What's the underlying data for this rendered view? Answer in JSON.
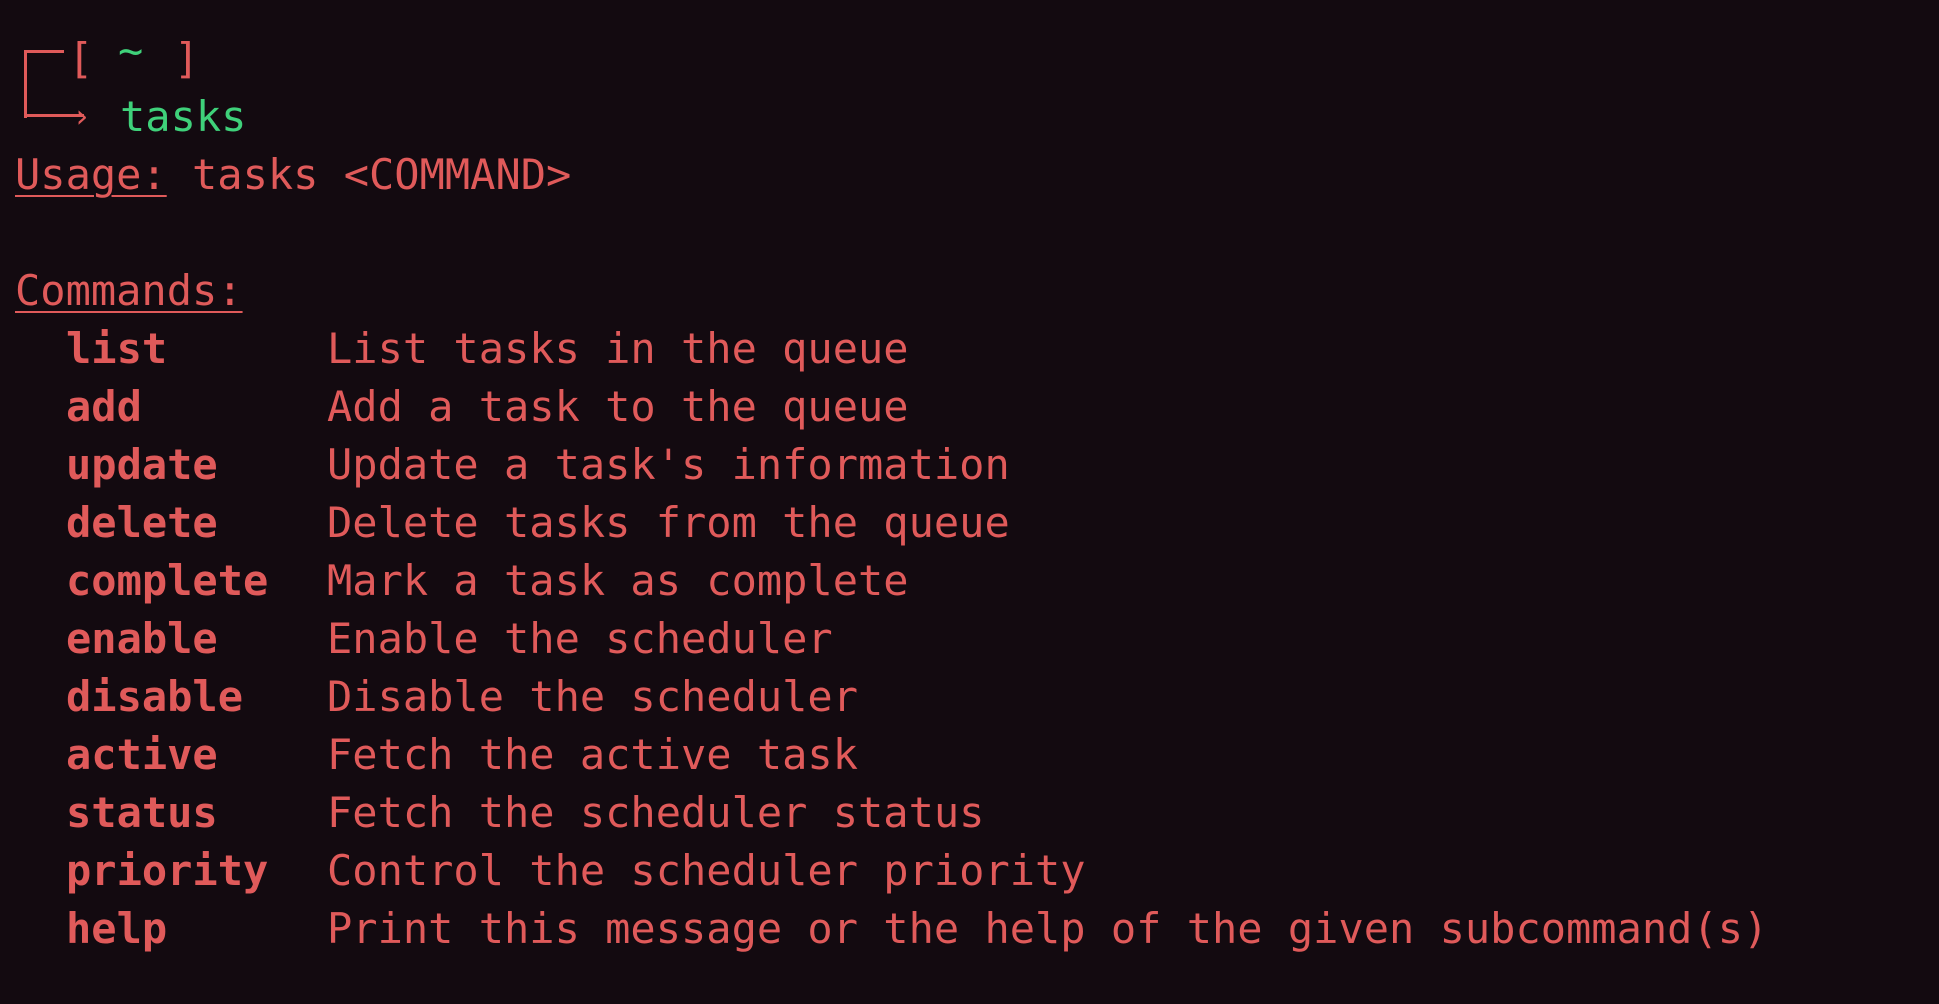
{
  "prompt": {
    "bracket_open": "[",
    "directory": "~",
    "bracket_close": "]",
    "command": "tasks"
  },
  "usage": {
    "label": "Usage:",
    "text": "tasks <COMMAND>"
  },
  "commands": {
    "heading": "Commands:",
    "items": [
      {
        "name": "list",
        "description": "List tasks in the queue"
      },
      {
        "name": "add",
        "description": "Add a task to the queue"
      },
      {
        "name": "update",
        "description": "Update a task's information"
      },
      {
        "name": "delete",
        "description": "Delete tasks from the queue"
      },
      {
        "name": "complete",
        "description": "Mark a task as complete"
      },
      {
        "name": "enable",
        "description": "Enable the scheduler"
      },
      {
        "name": "disable",
        "description": "Disable the scheduler"
      },
      {
        "name": "active",
        "description": "Fetch the active task"
      },
      {
        "name": "status",
        "description": "Fetch the scheduler status"
      },
      {
        "name": "priority",
        "description": "Control the scheduler priority"
      },
      {
        "name": "help",
        "description": "Print this message or the help of the given subcommand(s)"
      }
    ]
  },
  "colors": {
    "background": "#130a10",
    "text": "#e05a5a",
    "accent": "#3fd17a"
  }
}
